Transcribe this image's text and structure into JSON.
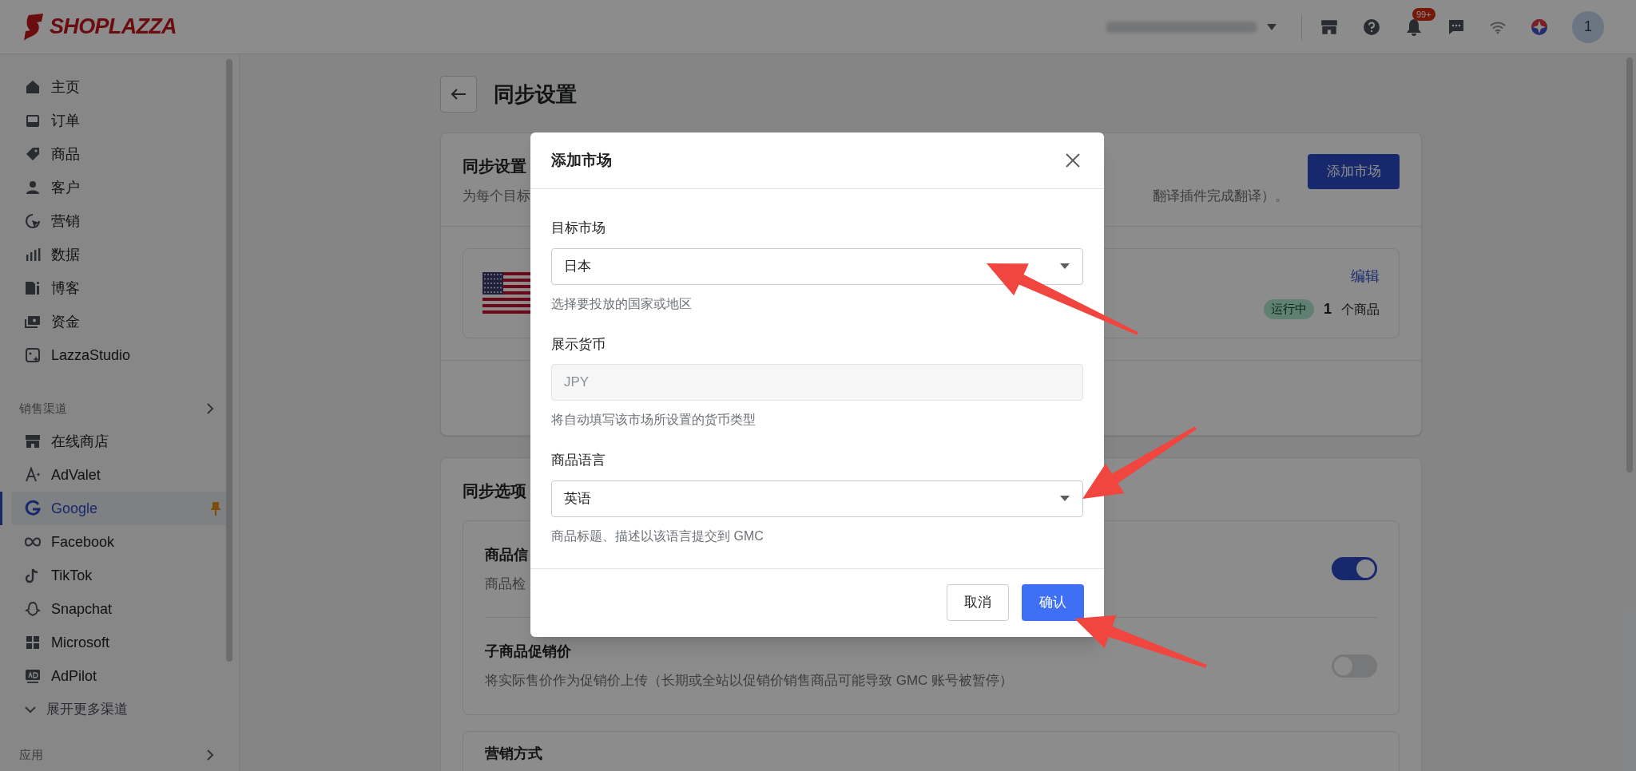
{
  "topbar": {
    "logo": "SHOPLAZZA",
    "notification_badge": "99+",
    "avatar": "1"
  },
  "sidebar": {
    "items": [
      {
        "label": "主页",
        "selected": false,
        "pinned": false
      },
      {
        "label": "订单",
        "selected": false,
        "pinned": false
      },
      {
        "label": "商品",
        "selected": false,
        "pinned": false
      },
      {
        "label": "客户",
        "selected": false,
        "pinned": false
      },
      {
        "label": "营销",
        "selected": false,
        "pinned": false
      },
      {
        "label": "数据",
        "selected": false,
        "pinned": false
      },
      {
        "label": "博客",
        "selected": false,
        "pinned": false
      },
      {
        "label": "资金",
        "selected": false,
        "pinned": false
      },
      {
        "label": "LazzaStudio",
        "selected": false,
        "pinned": false
      }
    ],
    "channels_header": "销售渠道",
    "channels": [
      {
        "label": "在线商店",
        "selected": false,
        "pinned": false
      },
      {
        "label": "AdValet",
        "selected": false,
        "pinned": false
      },
      {
        "label": "Google",
        "selected": true,
        "pinned": true
      },
      {
        "label": "Facebook",
        "selected": false,
        "pinned": false
      },
      {
        "label": "TikTok",
        "selected": false,
        "pinned": false
      },
      {
        "label": "Snapchat",
        "selected": false,
        "pinned": false
      },
      {
        "label": "Microsoft",
        "selected": false,
        "pinned": false
      },
      {
        "label": "AdPilot",
        "selected": false,
        "pinned": false
      }
    ],
    "more_channels": "展开更多渠道",
    "apps_header": "应用"
  },
  "page": {
    "title": "同步设置",
    "markets_card": {
      "title": "同步设置",
      "description_left": "为每个目标",
      "description_right": "翻译插件完成翻译）。",
      "add_button": "添加市场",
      "markets": [
        {
          "edit": "编辑",
          "status": "运行中",
          "count": "1",
          "count_unit": "个商品"
        }
      ]
    },
    "options_card": {
      "title": "同步选项",
      "options": [
        {
          "title": "商品信",
          "description": "商品检",
          "on": true
        },
        {
          "title": "子商品促销价",
          "description": "将实际售价作为促销价上传（长期或全站以促销价销售商品可能导致 GMC 账号被暂停）",
          "on": false
        }
      ]
    },
    "next_card": {
      "title": "营销方式"
    }
  },
  "modal": {
    "title": "添加市场",
    "fields": [
      {
        "label": "目标市场",
        "kind": "select",
        "value": "日本",
        "disabled": false,
        "help": "选择要投放的国家或地区"
      },
      {
        "label": "展示货币",
        "kind": "input",
        "value": "JPY",
        "disabled": true,
        "help": "将自动填写该市场所设置的货币类型"
      },
      {
        "label": "商品语言",
        "kind": "select",
        "value": "英语",
        "disabled": false,
        "help": "商品标题、描述以该语言提交到 GMC"
      }
    ],
    "buttons": [
      {
        "label": "取消",
        "primary": false
      },
      {
        "label": "确认",
        "primary": true
      }
    ]
  }
}
